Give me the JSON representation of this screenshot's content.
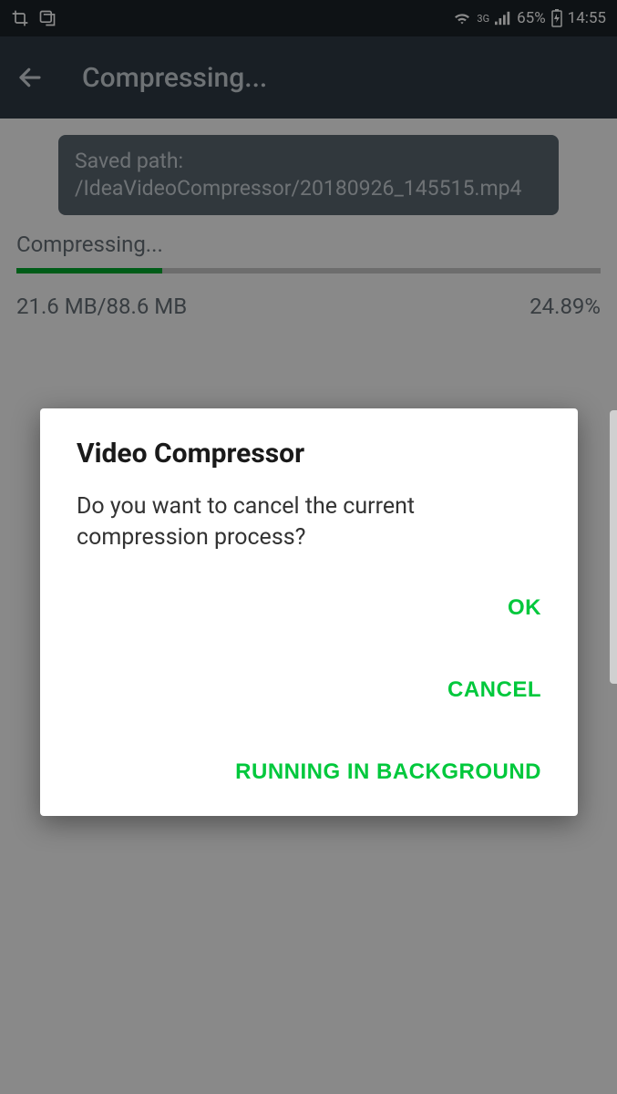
{
  "statusBar": {
    "battery": "65%",
    "time": "14:55",
    "network": "3G"
  },
  "appBar": {
    "title": "Compressing..."
  },
  "savedPath": {
    "label": "Saved path:",
    "value": "/IdeaVideoCompressor/20180926_145515.mp4"
  },
  "progress": {
    "label": "Compressing...",
    "current": "21.6 MB",
    "total": "88.6 MB",
    "sizeText": "21.6 MB/88.6 MB",
    "percent": "24.89%",
    "percentValue": 24.89
  },
  "dialog": {
    "title": "Video Compressor",
    "message": "Do you want to cancel the current compression process?",
    "buttons": {
      "ok": "OK",
      "cancel": "CANCEL",
      "background": "RUNNING IN BACKGROUND"
    }
  },
  "colors": {
    "accent": "#00c83c",
    "progressFill": "#00a82d",
    "appBarBg": "#2e3a44",
    "statusBg": "#1a2127"
  }
}
